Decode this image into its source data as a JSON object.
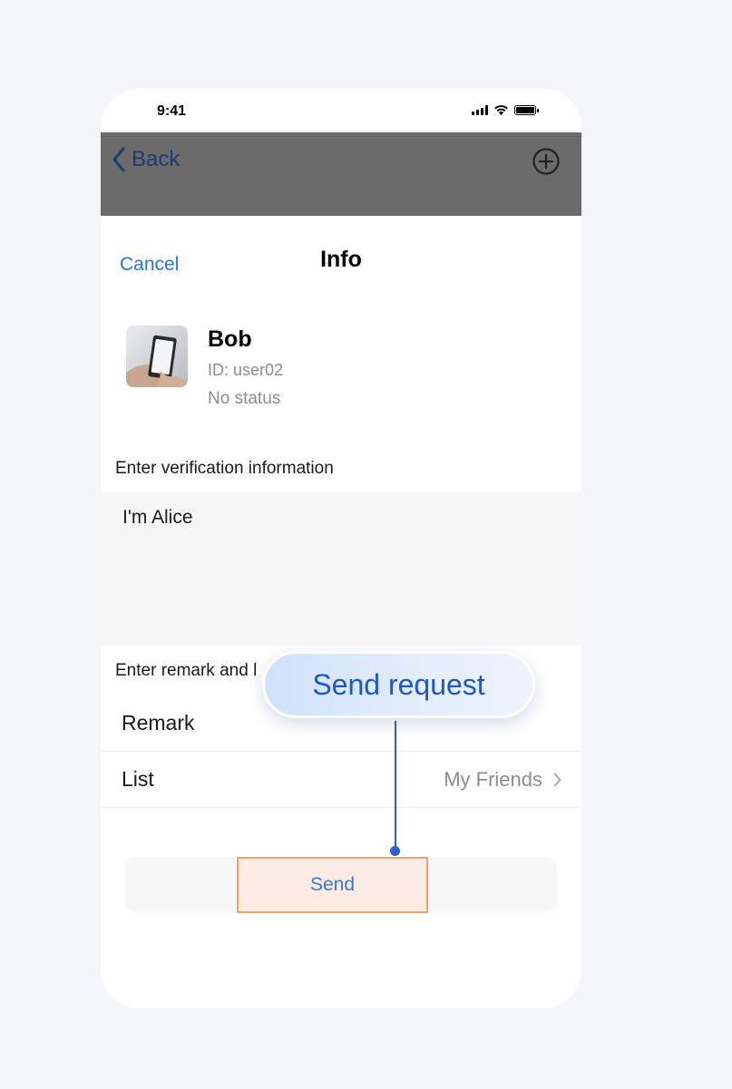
{
  "status_bar": {
    "time": "9:41"
  },
  "nav": {
    "back_label": "Back"
  },
  "sheet": {
    "cancel_label": "Cancel",
    "title": "Info"
  },
  "user": {
    "name": "Bob",
    "id_text": "ID: user02",
    "status": "No status"
  },
  "verification": {
    "label": "Enter verification information",
    "value": "I'm Alice"
  },
  "remark_section": {
    "label": "Enter remark and l",
    "rows": [
      {
        "label": "Remark",
        "value": ""
      },
      {
        "label": "List",
        "value": "My Friends"
      }
    ]
  },
  "send": {
    "label": "Send"
  },
  "callout": {
    "text": "Send request"
  },
  "colors": {
    "accent": "#2b72e0",
    "callout_text": "#1f57c7",
    "highlight_border": "#f0a36c",
    "highlight_fill": "#fcece3",
    "nav_overlay": "#6b6b6b"
  },
  "icons": {
    "back": "chevron-left-icon",
    "add": "plus-circle-icon",
    "disclosure": "chevron-right-icon",
    "signal": "cellular-signal-icon",
    "wifi": "wifi-icon",
    "battery": "battery-icon"
  }
}
